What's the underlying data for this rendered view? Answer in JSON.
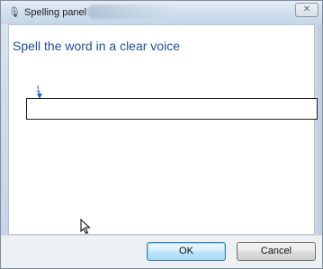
{
  "window": {
    "title": "Spelling panel",
    "close_label": "✕",
    "icon": "microphone-icon"
  },
  "content": {
    "prompt": "Spell the word in a clear voice",
    "marker_number": "1",
    "field_value": ""
  },
  "footer": {
    "ok_label": "OK",
    "cancel_label": "Cancel"
  },
  "colors": {
    "prompt_text": "#1c4f96",
    "marker": "#1f64c8",
    "ok_border": "#3c7fb1"
  }
}
